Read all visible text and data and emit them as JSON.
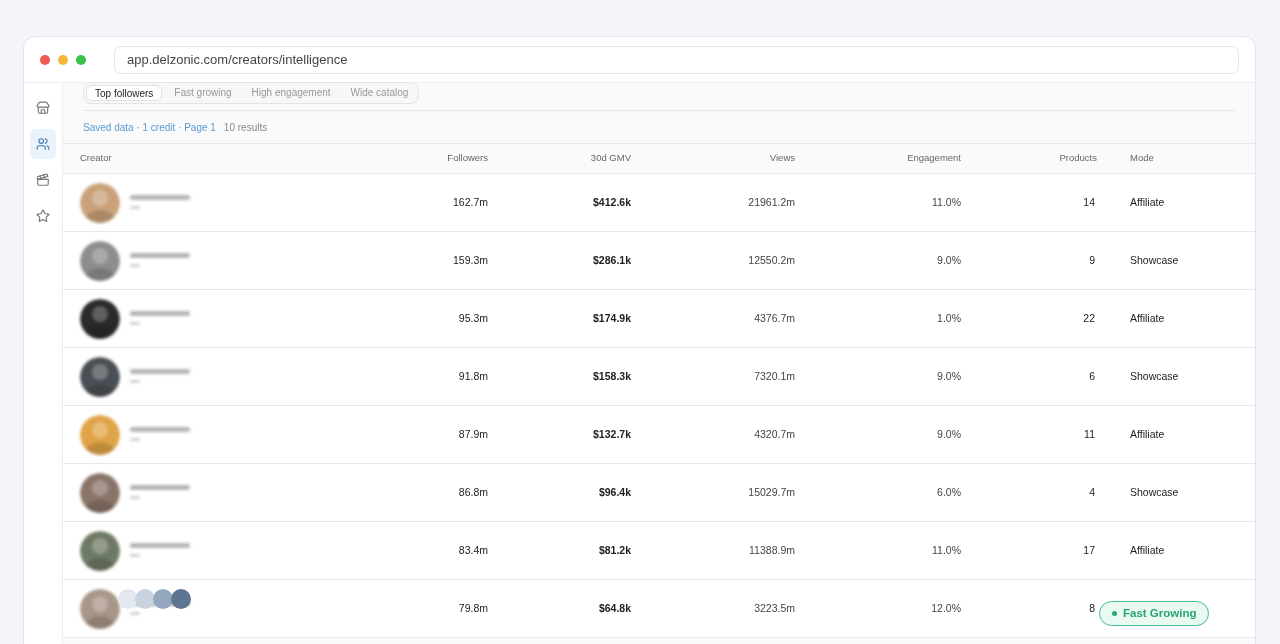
{
  "browser": {
    "url": "app.delzonic.com/creators/intelligence"
  },
  "sidebar": {
    "items": [
      {
        "selected": false
      },
      {
        "selected": true
      },
      {
        "selected": false
      },
      {
        "selected": false
      }
    ]
  },
  "tabs": [
    {
      "label": "Top followers",
      "selected": true
    },
    {
      "label": "Fast growing",
      "selected": false
    },
    {
      "label": "High engagement",
      "selected": false
    },
    {
      "label": "Wide catalog",
      "selected": false
    }
  ],
  "meta": {
    "source": "Saved data · 1 credit · Page 1",
    "results": "10 results"
  },
  "table": {
    "columns": [
      "Creator",
      "Followers",
      "30d GMV",
      "Views",
      "Engagement",
      "Products",
      "Mode"
    ],
    "rows": [
      {
        "followers": "162.7m",
        "gmv": "$412.6k",
        "views": "21961.2m",
        "engagement": "11.0%",
        "products": "14",
        "mode": "Affiliate"
      },
      {
        "followers": "159.3m",
        "gmv": "$286.1k",
        "views": "12550.2m",
        "engagement": "9.0%",
        "products": "9",
        "mode": "Showcase"
      },
      {
        "followers": "95.3m",
        "gmv": "$174.9k",
        "views": "4376.7m",
        "engagement": "1.0%",
        "products": "22",
        "mode": "Affiliate"
      },
      {
        "followers": "91.8m",
        "gmv": "$158.3k",
        "views": "7320.1m",
        "engagement": "9.0%",
        "products": "6",
        "mode": "Showcase"
      },
      {
        "followers": "87.9m",
        "gmv": "$132.7k",
        "views": "4320.7m",
        "engagement": "9.0%",
        "products": "11",
        "mode": "Affiliate"
      },
      {
        "followers": "86.8m",
        "gmv": "$96.4k",
        "views": "15029.7m",
        "engagement": "6.0%",
        "products": "4",
        "mode": "Showcase"
      },
      {
        "followers": "83.4m",
        "gmv": "$81.2k",
        "views": "11388.9m",
        "engagement": "11.0%",
        "products": "17",
        "mode": "Affiliate"
      },
      {
        "followers": "79.8m",
        "gmv": "$64.8k",
        "views": "3223.5m",
        "engagement": "12.0%",
        "products": "8"
      }
    ]
  },
  "floating_badge": {
    "label": "Fast Growing"
  }
}
